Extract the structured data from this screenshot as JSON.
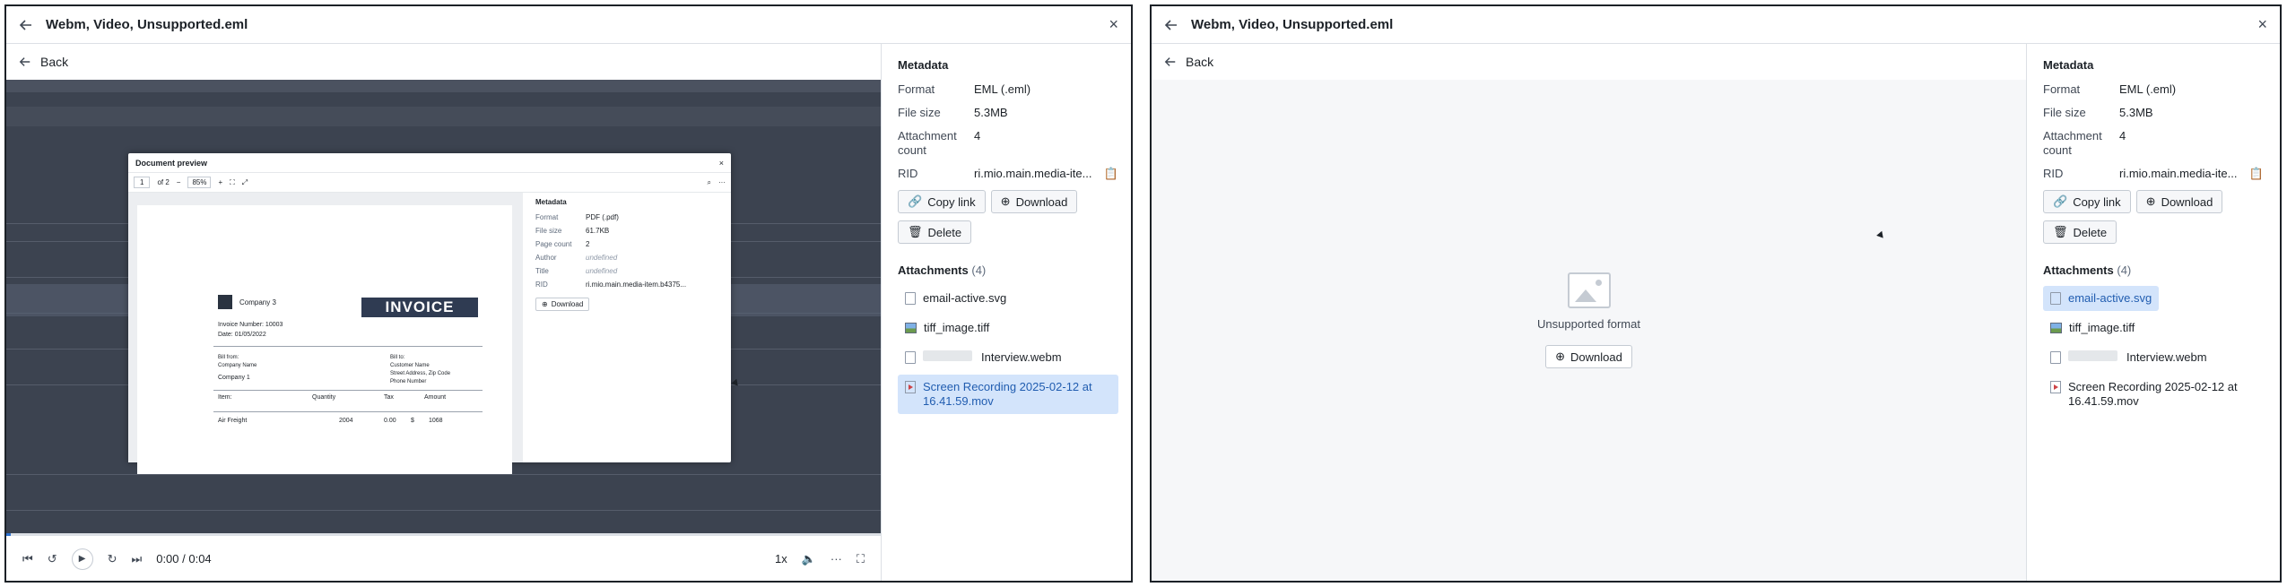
{
  "panels": [
    {
      "title": "Webm, Video, Unsupported.eml",
      "back_label": "Back",
      "metadata": {
        "heading": "Metadata",
        "rows": [
          {
            "key": "Format",
            "value": "EML (.eml)"
          },
          {
            "key": "File size",
            "value": "5.3MB"
          },
          {
            "key": "Attachment count",
            "value": "4"
          },
          {
            "key": "RID",
            "value": "ri.mio.main.media-ite..."
          }
        ],
        "copy_link": "Copy link",
        "download": "Download",
        "delete": "Delete"
      },
      "attachments": {
        "heading": "Attachments",
        "count": "(4)",
        "items": [
          {
            "name": "email-active.svg",
            "icon": "file-icon",
            "selected": false
          },
          {
            "name": "tiff_image.tiff",
            "icon": "image-icon",
            "selected": false
          },
          {
            "name": "Interview.webm",
            "icon": "file-icon",
            "selected": false
          },
          {
            "name": "Screen Recording 2025-02-12 at 16.41.59.mov",
            "icon": "video-icon",
            "selected": true
          }
        ]
      },
      "video": {
        "time": "0:00 / 0:04",
        "speed": "1x",
        "progress": 0.0,
        "inner": {
          "dialog_title": "Document preview",
          "page_input": "1",
          "page_of": "of 2",
          "zoom": "85%",
          "invoice": {
            "company": "Company 3",
            "heading": "INVOICE",
            "invoice_number_label": "Invoice Number:",
            "invoice_number": "10003",
            "date_label": "Date:",
            "date": "01/05/2022",
            "bill_from": "Bill from:",
            "bill_from_name": "Company Name",
            "bill_from_company": "Company 1",
            "bill_to": "Bill to:",
            "bill_to_lines": [
              "Customer Name",
              "Street Address, Zip Code",
              "Phone Number"
            ],
            "col_item": "Item:",
            "col_quantity": "Quantity",
            "col_tax": "Tax",
            "col_amount": "Amount",
            "row_item": "Air Freight",
            "row_quantity": "2004",
            "row_tax": "0.00",
            "row_currency": "$",
            "row_amount": "1068"
          },
          "meta": {
            "heading": "Metadata",
            "rows": [
              {
                "key": "Format",
                "value": "PDF (.pdf)",
                "italic": false
              },
              {
                "key": "File size",
                "value": "61.7KB",
                "italic": false
              },
              {
                "key": "Page count",
                "value": "2",
                "italic": false
              },
              {
                "key": "Author",
                "value": "undefined",
                "italic": true
              },
              {
                "key": "Title",
                "value": "undefined",
                "italic": true
              },
              {
                "key": "RID",
                "value": "ri.mio.main.media-item.b4375...",
                "italic": false
              }
            ],
            "download": "Download"
          }
        }
      }
    },
    {
      "title": "Webm, Video, Unsupported.eml",
      "back_label": "Back",
      "metadata": {
        "heading": "Metadata",
        "rows": [
          {
            "key": "Format",
            "value": "EML (.eml)"
          },
          {
            "key": "File size",
            "value": "5.3MB"
          },
          {
            "key": "Attachment count",
            "value": "4"
          },
          {
            "key": "RID",
            "value": "ri.mio.main.media-ite..."
          }
        ],
        "copy_link": "Copy link",
        "download": "Download",
        "delete": "Delete"
      },
      "attachments": {
        "heading": "Attachments",
        "count": "(4)",
        "items": [
          {
            "name": "email-active.svg",
            "icon": "file-icon",
            "selected": true
          },
          {
            "name": "tiff_image.tiff",
            "icon": "image-icon",
            "selected": false
          },
          {
            "name": "Interview.webm",
            "icon": "file-icon",
            "selected": false
          },
          {
            "name": "Screen Recording 2025-02-12 at 16.41.59.mov",
            "icon": "video-icon",
            "selected": false
          }
        ]
      },
      "unsupported": {
        "message": "Unsupported format",
        "download": "Download"
      }
    }
  ],
  "colors": {
    "selected_bg": "#d3e4fb",
    "selected_text": "#215db0",
    "border": "#1c2127",
    "video_bg": "#3c4350"
  }
}
